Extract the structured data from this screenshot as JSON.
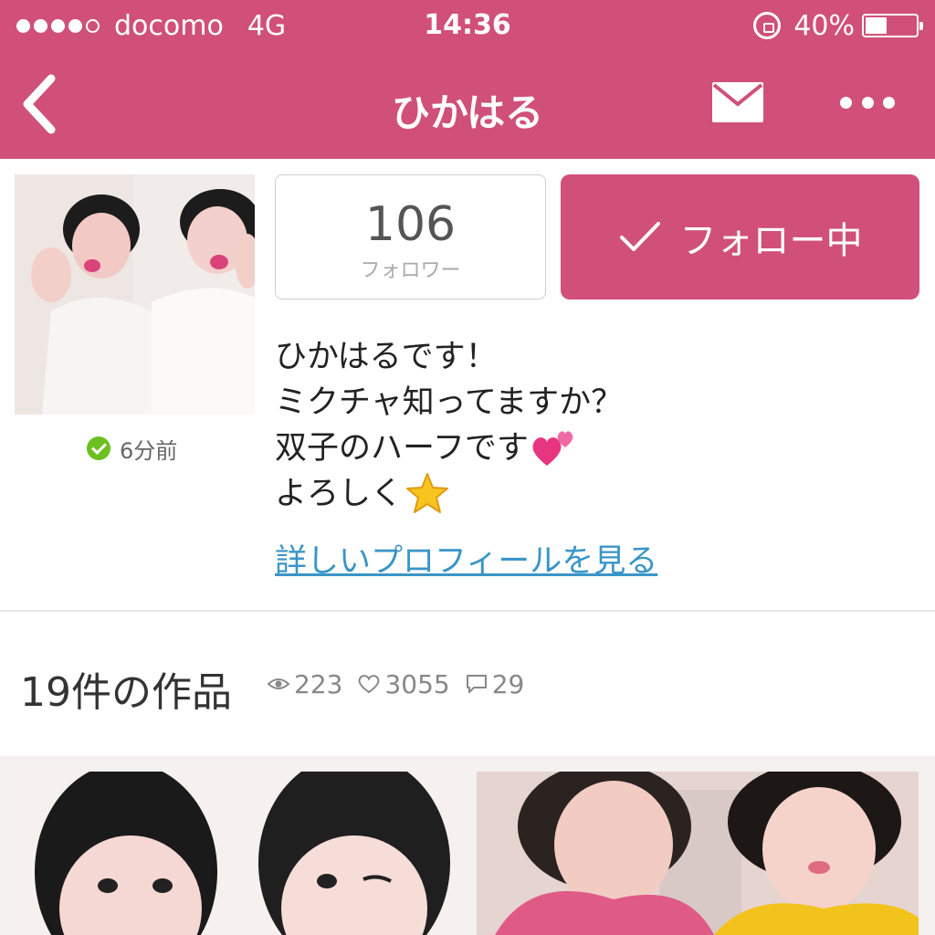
{
  "status_bar": {
    "carrier": "docomo",
    "network": "4G",
    "time": "14:36",
    "battery": "40%",
    "battery_level": 0.4
  },
  "nav": {
    "title": "ひかはる",
    "back_icon": "chevron-left-icon",
    "mail_icon": "mail-icon",
    "more_icon": "more-icon"
  },
  "profile": {
    "last_seen": "6分前",
    "followers_count": "106",
    "followers_label": "フォロワー",
    "follow_button_label": "フォロー中",
    "bio_lines": [
      "ひかはるです！",
      "ミクチャ知ってますか？",
      "双子のハーフです",
      "よろしく"
    ],
    "profile_link": "詳しいプロフィールを見る"
  },
  "works": {
    "title": "19件の作品",
    "views": "223",
    "likes": "3055",
    "comments": "29"
  },
  "colors": {
    "accent": "#d05079",
    "link": "#3a95c7",
    "online": "#6cc01f"
  }
}
